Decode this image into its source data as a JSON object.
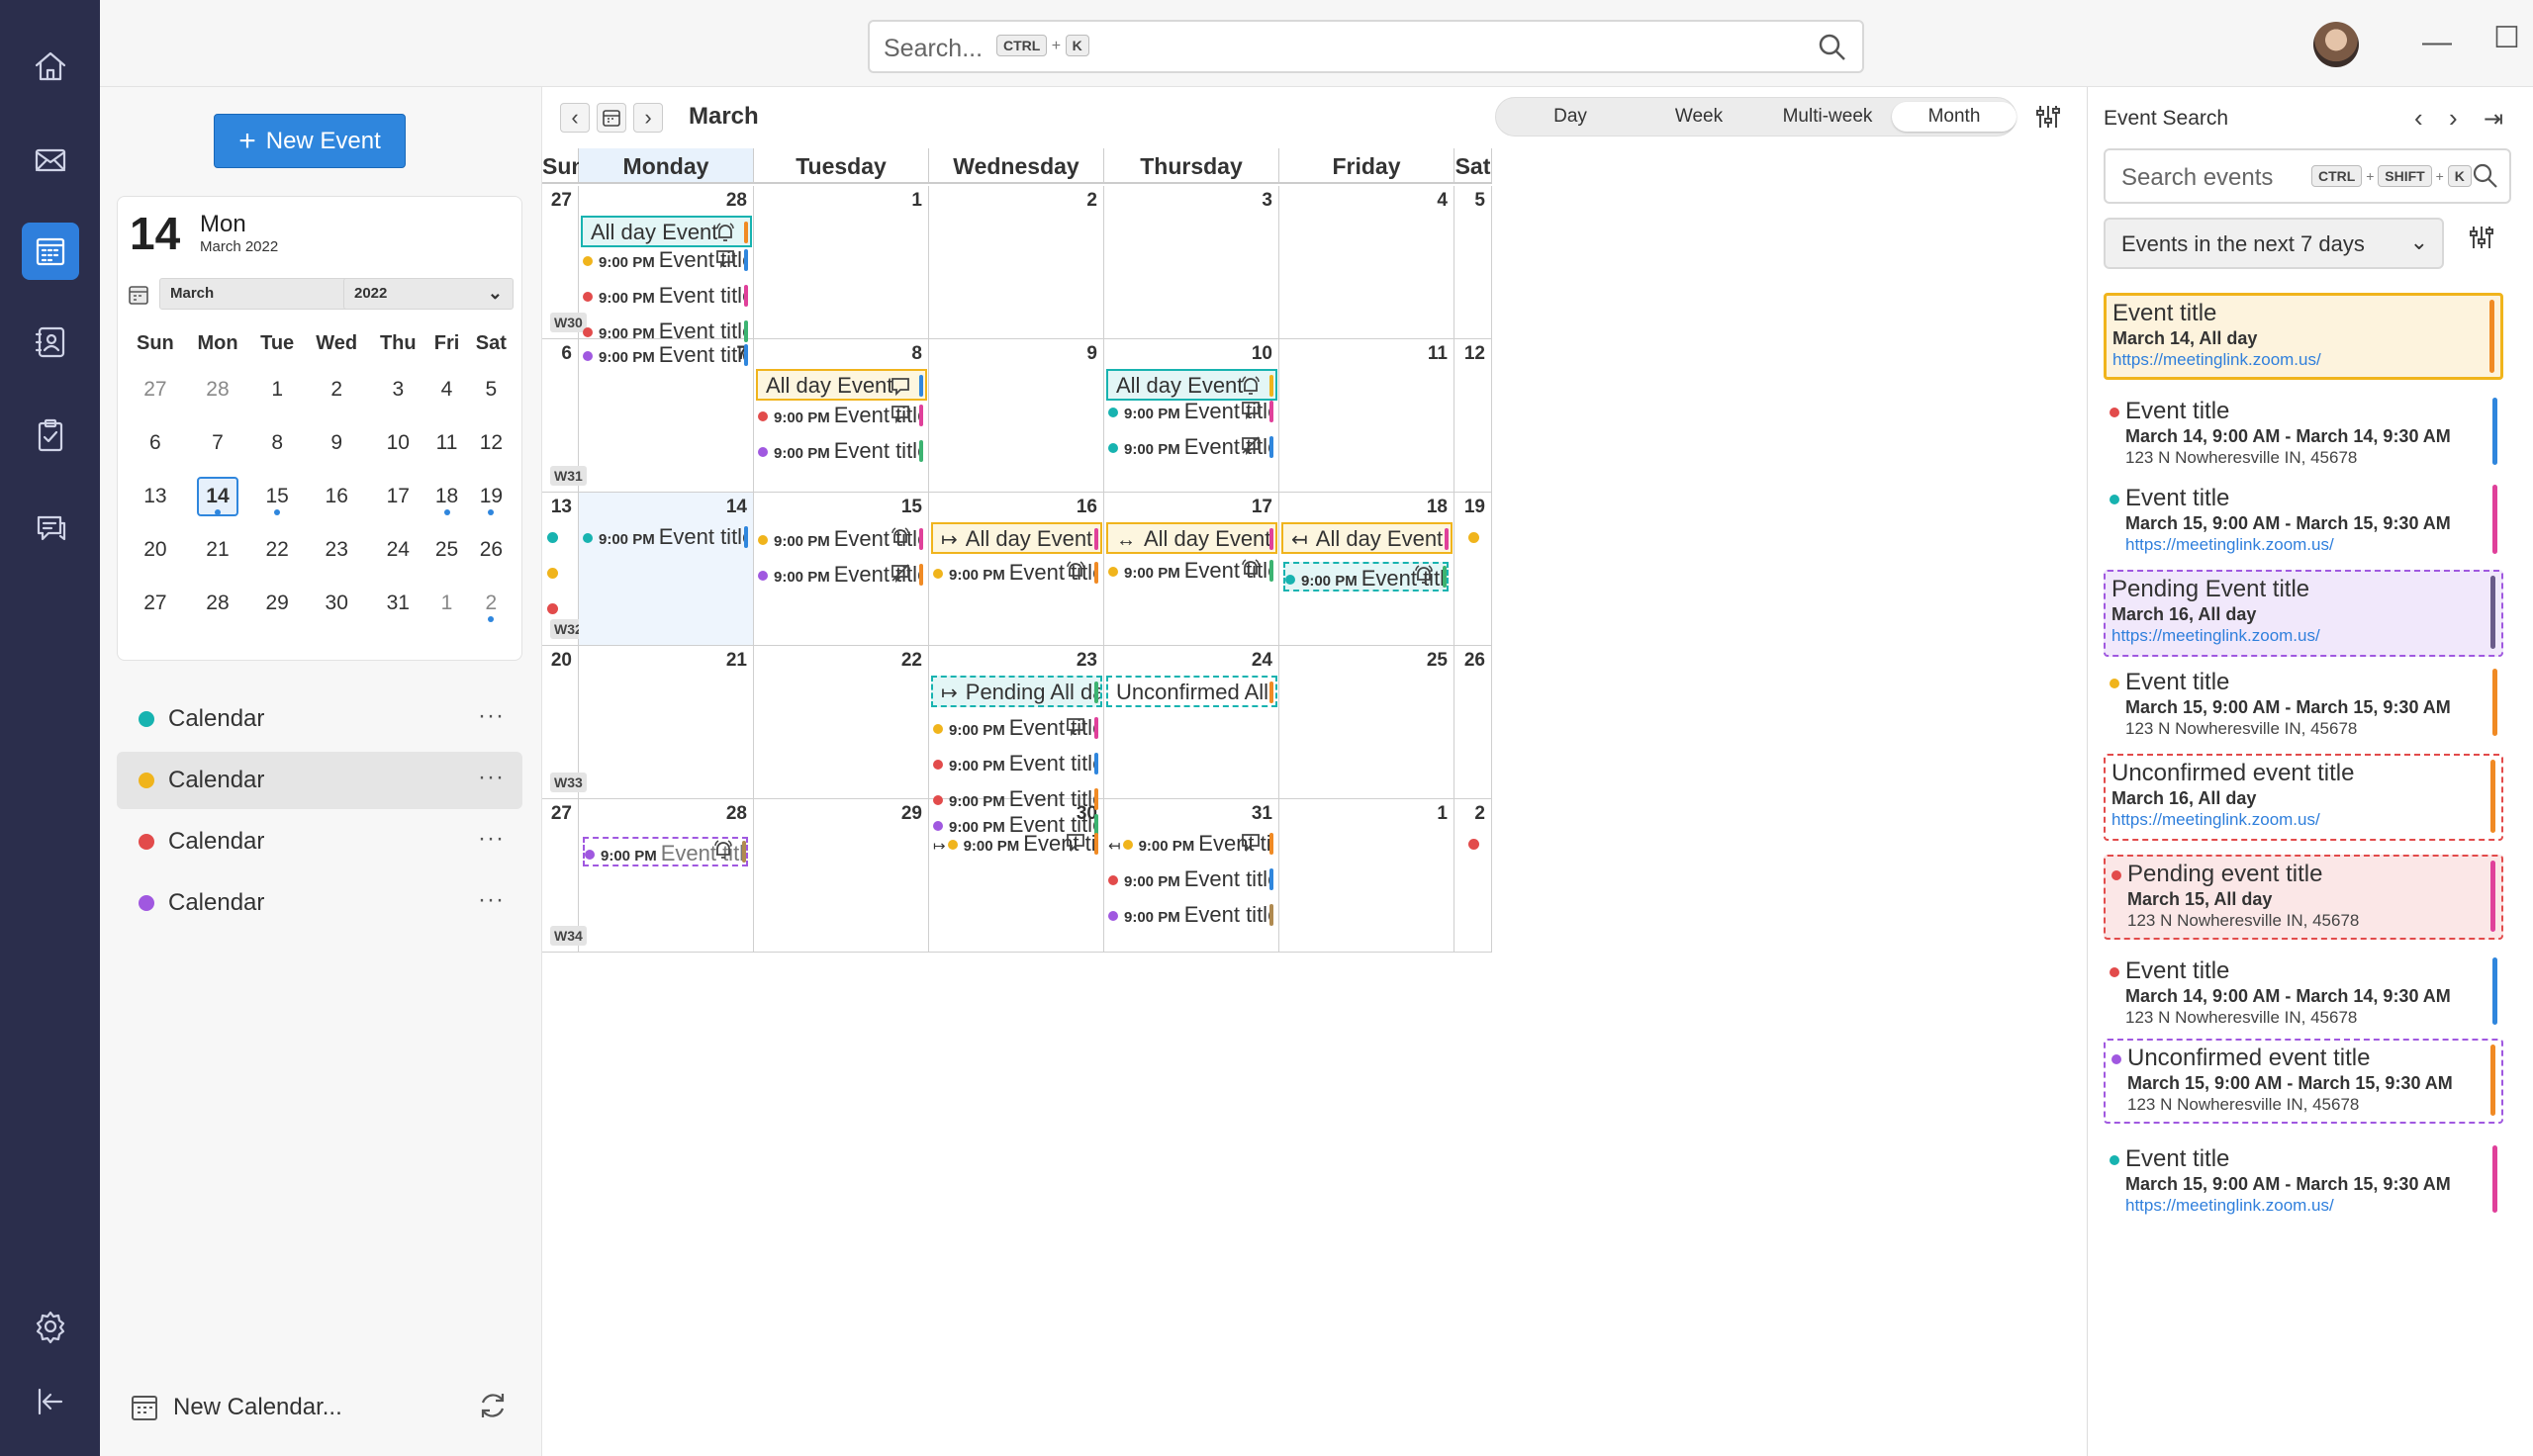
{
  "rail": {
    "items": [
      {
        "icon": "home-icon"
      },
      {
        "icon": "mail-icon"
      },
      {
        "icon": "calendar-icon",
        "active": true
      },
      {
        "icon": "contacts-icon"
      },
      {
        "icon": "tasks-icon"
      },
      {
        "icon": "chat-icon"
      }
    ],
    "bottom": [
      {
        "icon": "settings-icon"
      },
      {
        "icon": "collapse-icon"
      }
    ]
  },
  "topbar": {
    "search_placeholder": "Search...",
    "kbd1": "CTRL",
    "plus": "+",
    "kbd2": "K"
  },
  "left": {
    "new_event": "New Event",
    "minical": {
      "day": "14",
      "dow": "Mon",
      "month_year": "March 2022",
      "month_select": "March",
      "year_select": "2022",
      "weekdays": [
        "Sun",
        "Mon",
        "Tue",
        "Wed",
        "Thu",
        "Fri",
        "Sat"
      ],
      "weeks": [
        [
          "27",
          "28",
          "1",
          "2",
          "3",
          "4",
          "5"
        ],
        [
          "6",
          "7",
          "8",
          "9",
          "10",
          "11",
          "12"
        ],
        [
          "13",
          "14",
          "15",
          "16",
          "17",
          "18",
          "19"
        ],
        [
          "20",
          "21",
          "22",
          "23",
          "24",
          "25",
          "26"
        ],
        [
          "27",
          "28",
          "29",
          "30",
          "31",
          "1",
          "2"
        ]
      ]
    },
    "calendars": [
      {
        "label": "Calendar",
        "color": "#17b3b0"
      },
      {
        "label": "Calendar",
        "color": "#f0b41c"
      },
      {
        "label": "Calendar",
        "color": "#e24b4b"
      },
      {
        "label": "Calendar",
        "color": "#a058e0"
      }
    ],
    "more": "···",
    "new_calendar": "New Calendar..."
  },
  "main": {
    "month": "March",
    "views": [
      "Day",
      "Week",
      "Multi-week",
      "Month"
    ],
    "active_view": "Month",
    "days": [
      "Sun",
      "Monday",
      "Tuesday",
      "Wednesday",
      "Thursday",
      "Friday",
      "Sat"
    ],
    "weeks": [
      {
        "label": "W30",
        "dates": [
          "27",
          "28",
          "1",
          "2",
          "3",
          "4",
          "5"
        ]
      },
      {
        "label": "W31",
        "dates": [
          "6",
          "7",
          "8",
          "9",
          "10",
          "11",
          "12"
        ]
      },
      {
        "label": "W32",
        "dates": [
          "13",
          "14",
          "15",
          "16",
          "17",
          "18",
          "19"
        ]
      },
      {
        "label": "W33",
        "dates": [
          "20",
          "21",
          "22",
          "23",
          "24",
          "25",
          "26"
        ]
      },
      {
        "label": "W34",
        "dates": [
          "27",
          "28",
          "29",
          "30",
          "31",
          "1",
          "2"
        ]
      }
    ],
    "fri_first_date": "4",
    "time": "9:00 PM",
    "all_day": "All day Event",
    "ev_title_a": "Event title th...",
    "ev_title_b": "Event title...",
    "ev_title_c": "Event title th...",
    "pending_all_day": "Pending All day event",
    "unconfirmed_all_day": "Unconfirmed All day..."
  },
  "right": {
    "title": "Event Search",
    "search_placeholder": "Search events",
    "k1": "CTRL",
    "k2": "SHIFT",
    "k3": "K",
    "plus": "+",
    "range": "Events in the next 7 days",
    "results": [
      {
        "title": "Event title",
        "date": "March 14, All day",
        "link": "https://meetinglink.zoom.us/"
      },
      {
        "title": "Event title",
        "date": "March 14, 9:00 AM - March 14, 9:30 AM",
        "address": "123 N Nowheresville IN, 45678"
      },
      {
        "title": "Event title",
        "date": "March 15, 9:00 AM - March 15, 9:30 AM",
        "link": "https://meetinglink.zoom.us/"
      },
      {
        "title": "Pending Event title",
        "date": "March 16, All day",
        "link": "https://meetinglink.zoom.us/"
      },
      {
        "title": "Event title",
        "date": "March 15, 9:00 AM - March 15, 9:30 AM",
        "address": "123 N Nowheresville IN, 45678"
      },
      {
        "title": "Unconfirmed event title",
        "date": "March 16, All day",
        "link": "https://meetinglink.zoom.us/"
      },
      {
        "title": "Pending event title",
        "date": "March 15, All day",
        "address": "123 N Nowheresville IN, 45678"
      },
      {
        "title": "Event title",
        "date": "March 14, 9:00 AM - March 14, 9:30 AM",
        "address": "123 N Nowheresville IN, 45678"
      },
      {
        "title": "Unconfirmed event title",
        "date": "March 15, 9:00 AM - March 15, 9:30 AM",
        "address": "123 N Nowheresville IN, 45678"
      },
      {
        "title": "Event title",
        "date": "March 15, 9:00 AM - March 15, 9:30 AM",
        "link": "https://meetinglink.zoom.us/"
      }
    ]
  },
  "colors": {
    "teal": "#17b3b0",
    "yellow": "#f0b41c",
    "red": "#e24b4b",
    "purple": "#a058e0",
    "blue": "#2f86dd",
    "pink": "#e0409a",
    "green": "#3cb371",
    "orange": "#f08a24",
    "brown": "#b08a50",
    "accent": "#2f86dd"
  }
}
